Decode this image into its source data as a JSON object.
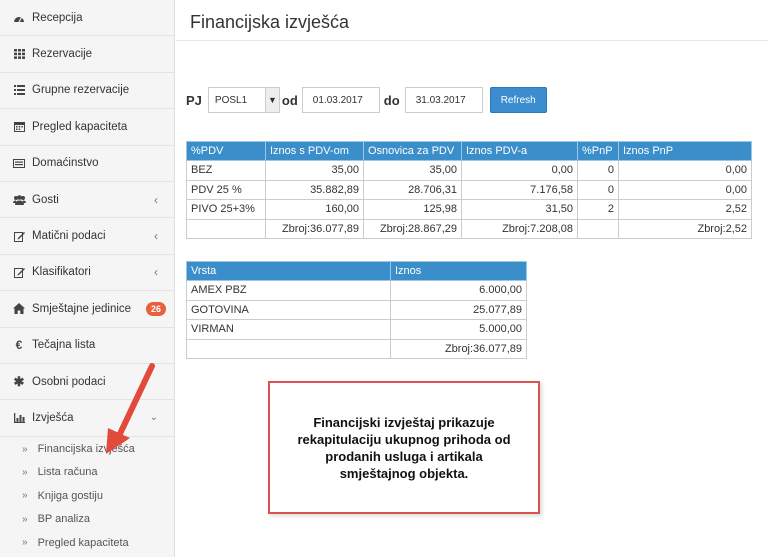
{
  "sidebar": {
    "items": [
      {
        "label": "Recepcija",
        "icon": "dashboard-icon"
      },
      {
        "label": "Rezervacije",
        "icon": "grid-icon"
      },
      {
        "label": "Grupne rezervacije",
        "icon": "list-icon"
      },
      {
        "label": "Pregled kapaciteta",
        "icon": "calendar-icon"
      },
      {
        "label": "Domaćinstvo",
        "icon": "card-icon"
      },
      {
        "label": "Gosti",
        "icon": "users-icon"
      },
      {
        "label": "Matični podaci",
        "icon": "edit-icon"
      },
      {
        "label": "Klasifikatori",
        "icon": "edit-icon"
      },
      {
        "label": "Smještajne jedinice",
        "icon": "home-icon",
        "badge": "26"
      },
      {
        "label": "Tečajna lista",
        "icon": "euro-icon"
      },
      {
        "label": "Osobni podaci",
        "icon": "asterisk-icon"
      },
      {
        "label": "Izvješća",
        "icon": "bar-chart-icon"
      }
    ],
    "sub_items": [
      "Financijska izvješća",
      "Lista računa",
      "Knjiga gostiju",
      "BP analiza",
      "Pregled kapaciteta"
    ]
  },
  "page": {
    "title": "Financijska izvješća"
  },
  "filter": {
    "pj_label": "PJ",
    "pj_value": "POSL1",
    "od_label": "od",
    "od_value": "01.03.2017",
    "do_label": "do",
    "do_value": "31.03.2017",
    "refresh_label": "Refresh"
  },
  "pdv_table": {
    "headers": [
      "%PDV",
      "Iznos s PDV-om",
      "Osnovica za PDV",
      "Iznos PDV-a",
      "%PnP",
      "Iznos PnP"
    ],
    "rows": [
      [
        "BEZ",
        "35,00",
        "35,00",
        "0,00",
        "0",
        "0,00"
      ],
      [
        "PDV 25 %",
        "35.882,89",
        "28.706,31",
        "7.176,58",
        "0",
        "0,00"
      ],
      [
        "PIVO 25+3%",
        "160,00",
        "125,98",
        "31,50",
        "2",
        "2,52"
      ],
      [
        "",
        "Zbroj:36.077,89",
        "Zbroj:28.867,29",
        "Zbroj:7.208,08",
        "",
        "Zbroj:2,52"
      ]
    ]
  },
  "vrsta_table": {
    "headers": [
      "Vrsta",
      "Iznos"
    ],
    "rows": [
      [
        "AMEX PBZ",
        "6.000,00"
      ],
      [
        "GOTOVINA",
        "25.077,89"
      ],
      [
        "VIRMAN",
        "5.000,00"
      ],
      [
        "",
        "Zbroj:36.077,89"
      ]
    ]
  },
  "note": {
    "text": "Financijski izvještaj prikazuje rekapitulaciju ukupnog prihoda od prodanih usluga i artikala smještajnog objekta."
  },
  "colors": {
    "accent": "#3a8fca",
    "badge": "#e8603c",
    "note_border": "#d9534f",
    "arrow": "#e24a3b"
  }
}
